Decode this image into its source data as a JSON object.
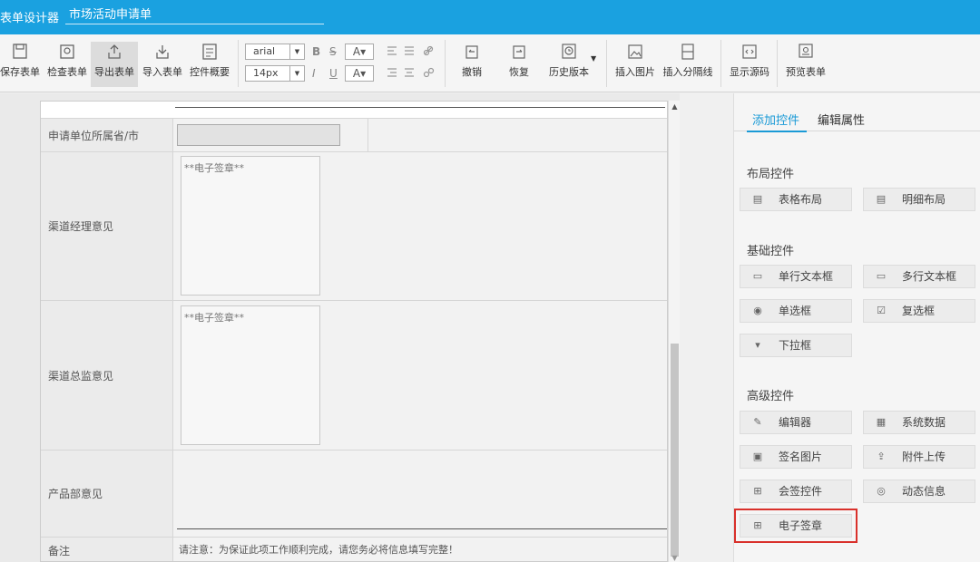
{
  "titlebar": {
    "app_title": "表单设计器",
    "doc_tab": "市场活动申请单"
  },
  "toolbar": {
    "save": "保存表单",
    "check": "检查表单",
    "export": "导出表单",
    "import": "导入表单",
    "overview": "控件概要",
    "font_family": "arial",
    "font_size": "14px",
    "bold": "B",
    "strike": "S",
    "italic": "I",
    "underline": "U",
    "color": "A",
    "undo": "撤销",
    "redo": "恢复",
    "history": "历史版本",
    "insert_image": "插入图片",
    "insert_divider": "插入分隔线",
    "show_source": "显示源码",
    "preview": "预览表单"
  },
  "form": {
    "rows": [
      {
        "label": "申请单位所属省/市"
      },
      {
        "label": "渠道经理意见",
        "signature": "**电子签章**"
      },
      {
        "label": "渠道总监意见",
        "signature": "**电子签章**"
      },
      {
        "label": "产品部意见"
      },
      {
        "label": "备注",
        "note": "请注意：为保证此项工作顺利完成，请您务必将信息填写完整！"
      }
    ]
  },
  "panel": {
    "tab_add": "添加控件",
    "tab_edit": "编辑属性",
    "layout_title": "布局控件",
    "layout": [
      "表格布局",
      "明细布局"
    ],
    "basic_title": "基础控件",
    "basic": [
      "单行文本框",
      "多行文本框",
      "单选框",
      "复选框",
      "下拉框"
    ],
    "advanced_title": "高级控件",
    "advanced": [
      "编辑器",
      "系统数据",
      "签名图片",
      "附件上传",
      "会签控件",
      "动态信息",
      "电子签章"
    ]
  },
  "colors": {
    "accent": "#1aa1e0",
    "highlight": "#d9302b"
  }
}
